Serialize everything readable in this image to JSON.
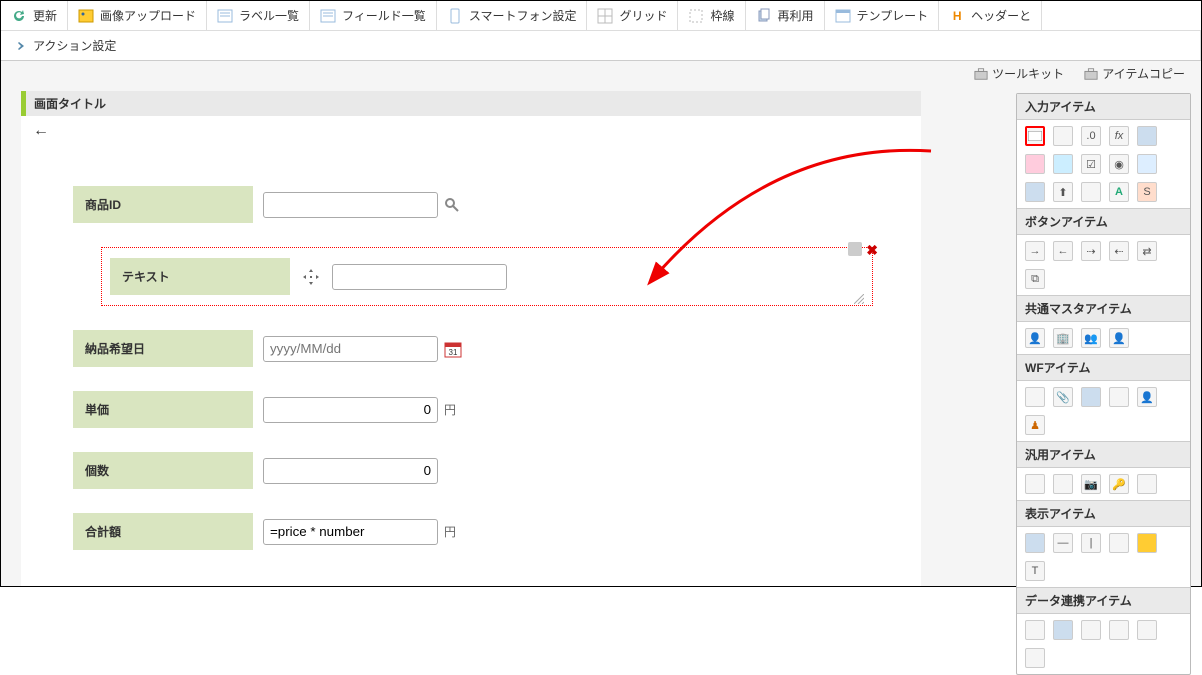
{
  "toolbar": {
    "update": "更新",
    "upload": "画像アップロード",
    "label_list": "ラベル一覧",
    "field_list": "フィールド一覧",
    "smartphone": "スマートフォン設定",
    "grid": "グリッド",
    "frame": "枠線",
    "reuse": "再利用",
    "template": "テンプレート",
    "header_and": "ヘッダーと",
    "action_settings": "アクション設定"
  },
  "tabs": {
    "toolkit": "ツールキット",
    "item_copy": "アイテムコピー"
  },
  "canvas": {
    "screen_title": "画面タイトル"
  },
  "form": {
    "product_id": {
      "label": "商品ID",
      "value": ""
    },
    "text_field": {
      "label": "テキスト",
      "value": ""
    },
    "delivery_date": {
      "label": "納品希望日",
      "placeholder": "yyyy/MM/dd"
    },
    "unit_price": {
      "label": "単価",
      "value": "0",
      "suffix": "円"
    },
    "quantity": {
      "label": "個数",
      "value": "0"
    },
    "total": {
      "label": "合計額",
      "value": "=price * number",
      "suffix": "円"
    }
  },
  "toolkit": {
    "input_items": "入力アイテム",
    "button_items": "ボタンアイテム",
    "common_master_items": "共通マスタアイテム",
    "wf_items": "WFアイテム",
    "general_items": "汎用アイテム",
    "display_items": "表示アイテム",
    "data_link_items": "データ連携アイテム"
  }
}
